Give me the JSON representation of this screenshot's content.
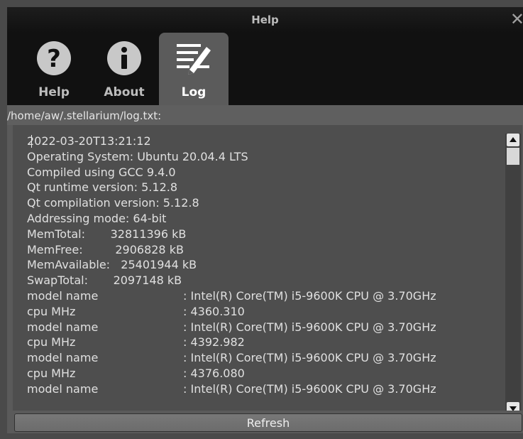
{
  "window": {
    "title": "Help"
  },
  "tabs": [
    {
      "label": "Help",
      "icon": "question-icon"
    },
    {
      "label": "About",
      "icon": "info-icon"
    },
    {
      "label": "Log",
      "icon": "log-pencil-icon",
      "active": true
    }
  ],
  "log": {
    "path": "/home/aw/.stellarium/log.txt:",
    "lines": [
      "2022-03-20T13:21:12",
      "Operating System: Ubuntu 20.04.4 LTS",
      "Compiled using GCC 9.4.0",
      "Qt runtime version: 5.12.8",
      "Qt compilation version: 5.12.8",
      "Addressing mode: 64-bit",
      "MemTotal:       32811396 kB",
      "MemFree:         2906828 kB",
      "MemAvailable:   25401944 kB",
      "SwapTotal:       2097148 kB",
      "model name\t\t: Intel(R) Core(TM) i5-9600K CPU @ 3.70GHz",
      "cpu MHz\t\t: 4360.310",
      "model name\t\t: Intel(R) Core(TM) i5-9600K CPU @ 3.70GHz",
      "cpu MHz\t\t: 4392.982",
      "model name\t\t: Intel(R) Core(TM) i5-9600K CPU @ 3.70GHz",
      "cpu MHz\t\t: 4376.080",
      "model name\t\t: Intel(R) Core(TM) i5-9600K CPU @ 3.70GHz"
    ]
  },
  "buttons": {
    "refresh": "Refresh"
  },
  "colors": {
    "titlebar": "#111111",
    "panel": "#5a5a5a",
    "log_bg": "#4e4e4e",
    "text": "#e0e0e0"
  }
}
